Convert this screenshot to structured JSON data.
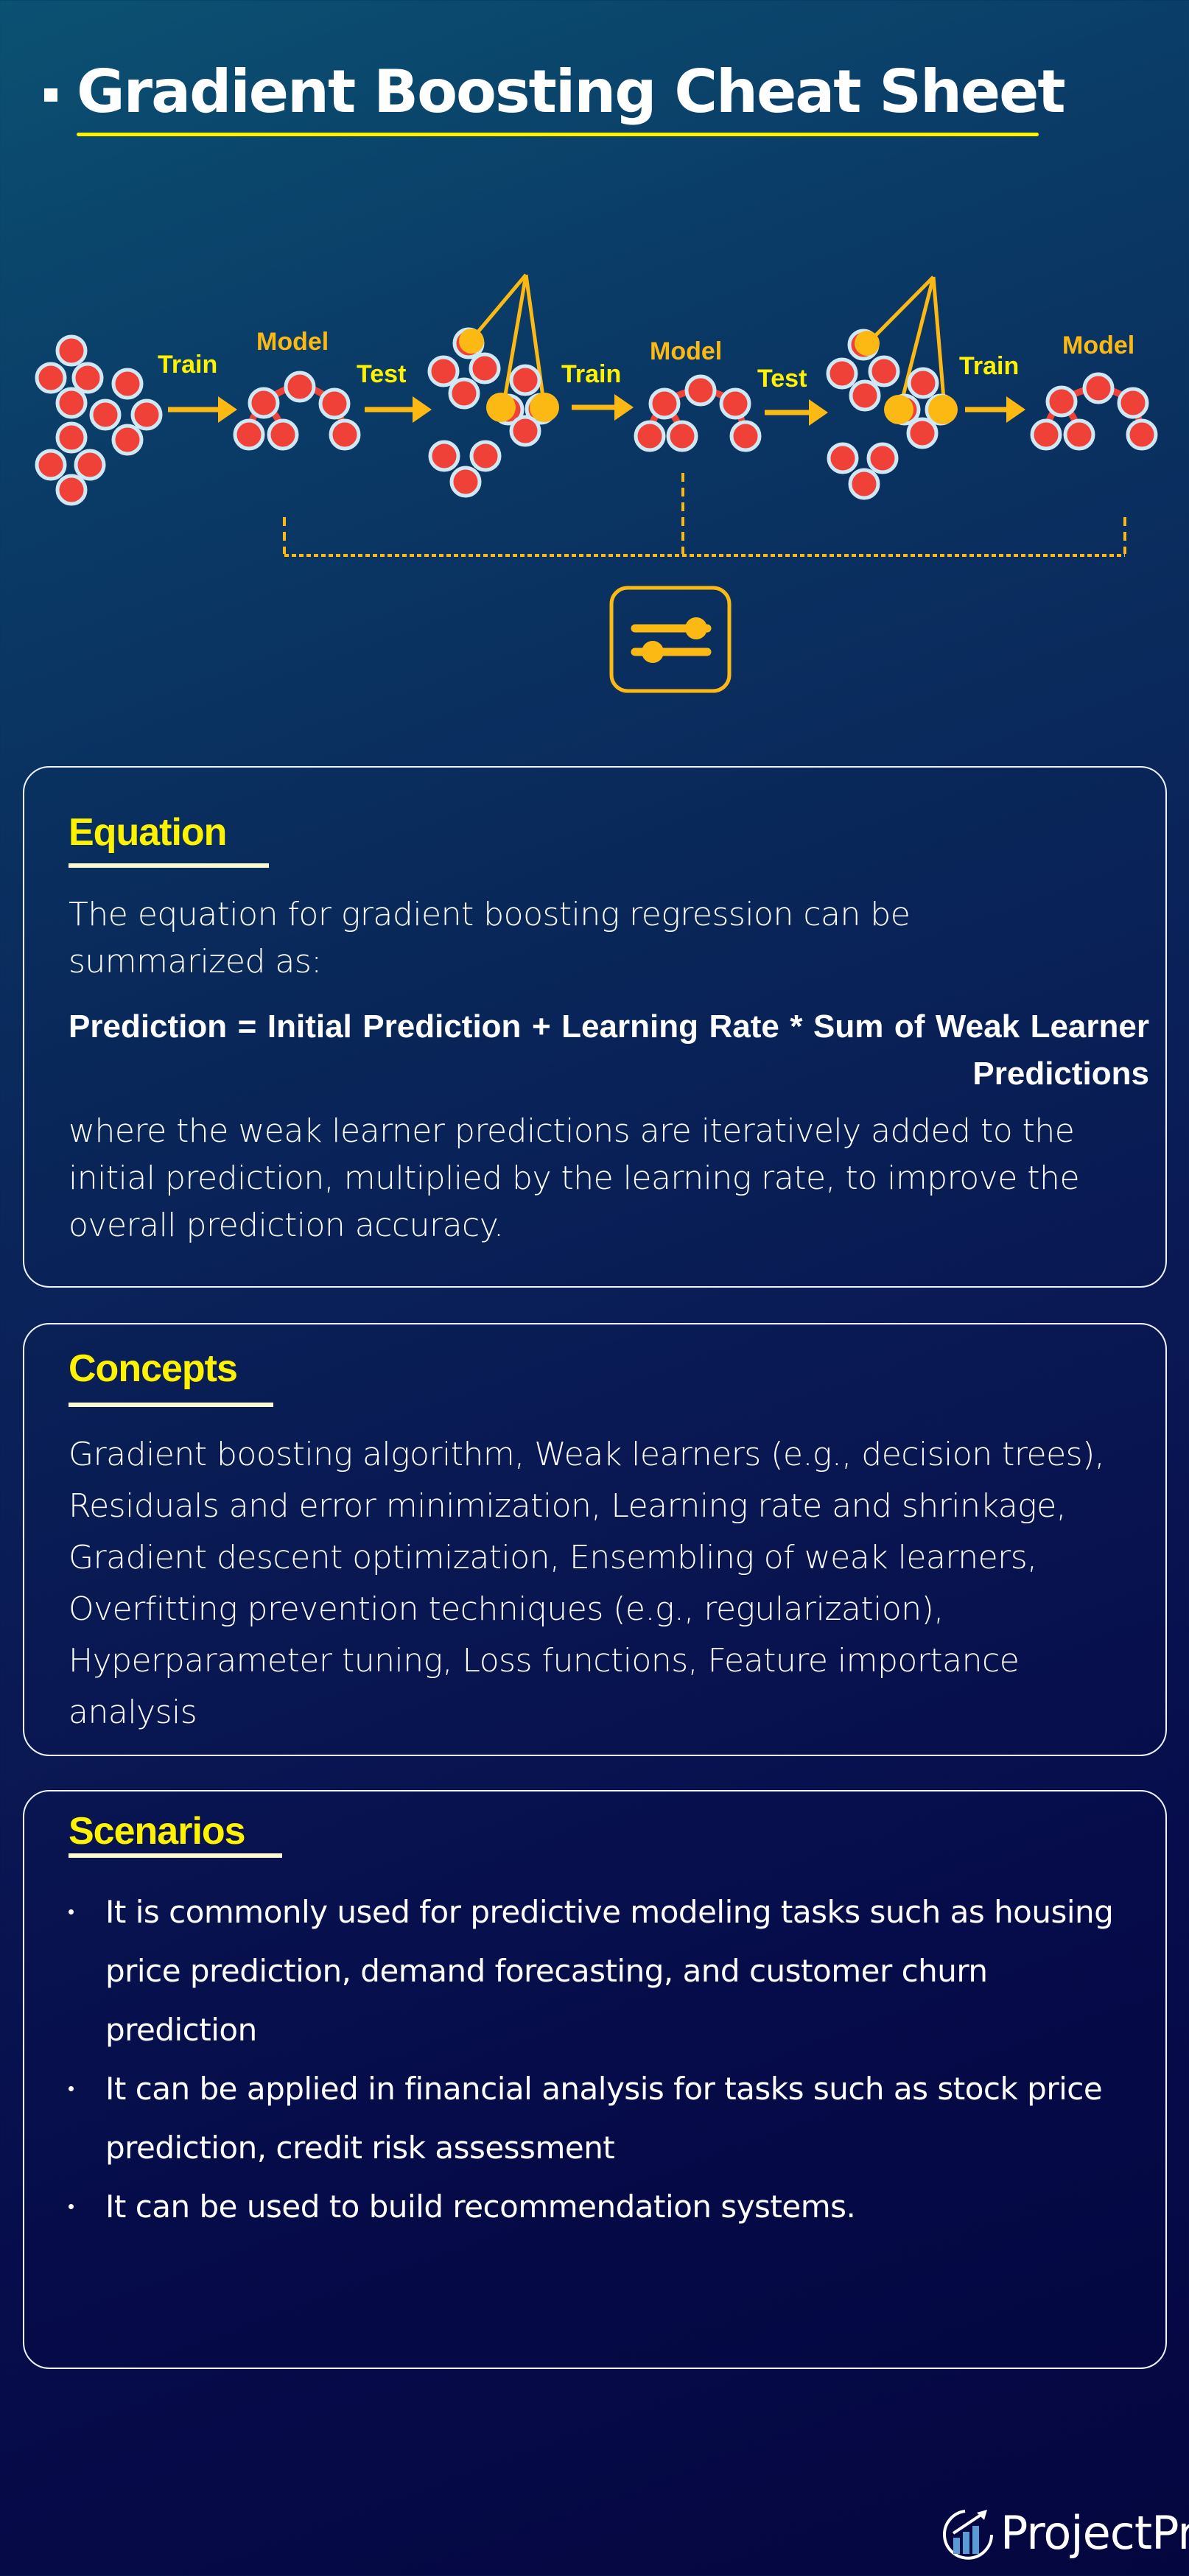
{
  "header": {
    "title": "Gradient Boosting Cheat Sheet",
    "accent_color": "#fff200"
  },
  "diagram": {
    "labels": {
      "train1": "Train",
      "model1": "Model",
      "test1": "Test",
      "train2": "Train",
      "model2": "Model",
      "test2": "Test",
      "train3": "Train",
      "model3": "Model"
    },
    "colors": {
      "node_fill": "#ef4137",
      "node_ring": "#cfe8f5",
      "highlight": "#fdb913",
      "arrow": "#fdb913",
      "label_yellow": "#fff200",
      "label_orange": "#fdb913"
    },
    "icon": "sliders-icon"
  },
  "equation": {
    "heading": "Equation",
    "intro": "The equation for gradient boosting regression can be summarized as:",
    "formula": "Prediction = Initial Prediction + Learning Rate * Sum of Weak Learner Predictions",
    "explanation": "where the weak learner predictions are iteratively added to the initial prediction, multiplied by the learning rate, to improve the overall prediction accuracy."
  },
  "concepts": {
    "heading": "Concepts",
    "text": "Gradient boosting algorithm, Weak learners (e.g., decision trees), Residuals and error minimization, Learning rate and shrinkage, Gradient descent optimization, Ensembling of weak learners, Overfitting prevention techniques (e.g., regularization), Hyperparameter tuning, Loss functions, Feature importance analysis"
  },
  "scenarios": {
    "heading": "Scenarios",
    "items": [
      "It is commonly used for predictive modeling tasks such as housing price prediction, demand forecasting, and customer churn prediction",
      "It can be applied in financial analysis for tasks such as stock price prediction, credit risk assessment",
      "It can be used to build recommendation systems."
    ]
  },
  "footer": {
    "brand": "ProjectPro"
  }
}
